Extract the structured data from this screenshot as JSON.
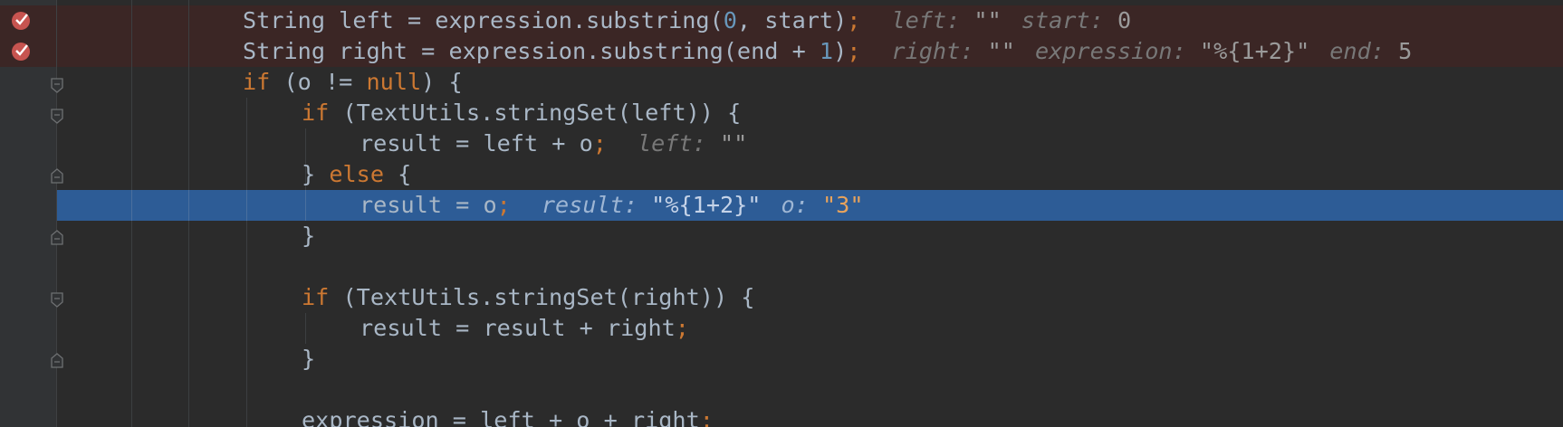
{
  "editor": {
    "lines": [
      {
        "id": "line-1",
        "tokens": [
          {
            "t": "String left = expression.substring(",
            "c": ""
          },
          {
            "t": "0",
            "c": "num"
          },
          {
            "t": ", start)",
            "c": ""
          },
          {
            "t": ";",
            "c": "semi"
          }
        ],
        "hints": [
          {
            "name": "left:",
            "value": "\"\""
          },
          {
            "name": "start:",
            "value": "0"
          }
        ]
      },
      {
        "id": "line-2",
        "tokens": [
          {
            "t": "String right = expression.substring(end + ",
            "c": ""
          },
          {
            "t": "1",
            "c": "num"
          },
          {
            "t": ")",
            "c": ""
          },
          {
            "t": ";",
            "c": "semi"
          }
        ],
        "hints": [
          {
            "name": "right:",
            "value": "\"\""
          },
          {
            "name": "expression:",
            "value": "\"%{1+2}\""
          },
          {
            "name": "end:",
            "value": "5"
          }
        ]
      },
      {
        "id": "line-3",
        "tokens": [
          {
            "t": "if",
            "c": "kw"
          },
          {
            "t": " (o != ",
            "c": ""
          },
          {
            "t": "null",
            "c": "kw"
          },
          {
            "t": ") {",
            "c": ""
          }
        ],
        "hints": []
      },
      {
        "id": "line-4",
        "tokens": [
          {
            "t": "if",
            "c": "kw"
          },
          {
            "t": " (TextUtils.stringSet(left)) {",
            "c": ""
          }
        ],
        "hints": []
      },
      {
        "id": "line-5",
        "tokens": [
          {
            "t": "result = left + o",
            "c": ""
          },
          {
            "t": ";",
            "c": "semi"
          }
        ],
        "hints": [
          {
            "name": "left:",
            "value": "\"\""
          }
        ]
      },
      {
        "id": "line-6",
        "tokens": [
          {
            "t": "} ",
            "c": ""
          },
          {
            "t": "else",
            "c": "kw"
          },
          {
            "t": " {",
            "c": ""
          }
        ],
        "hints": []
      },
      {
        "id": "line-7",
        "tokens": [
          {
            "t": "result = o",
            "c": ""
          },
          {
            "t": ";",
            "c": "semi"
          }
        ],
        "hints": [
          {
            "name": "result:",
            "value": "\"%{1+2}\""
          },
          {
            "name": "o:",
            "value": "\"3\"",
            "changed": true
          }
        ]
      },
      {
        "id": "line-8",
        "tokens": [
          {
            "t": "}",
            "c": ""
          }
        ],
        "hints": []
      },
      {
        "id": "line-9",
        "tokens": [],
        "hints": []
      },
      {
        "id": "line-10",
        "tokens": [
          {
            "t": "if",
            "c": "kw"
          },
          {
            "t": " (TextUtils.stringSet(right)) {",
            "c": ""
          }
        ],
        "hints": []
      },
      {
        "id": "line-11",
        "tokens": [
          {
            "t": "result = result + right",
            "c": ""
          },
          {
            "t": ";",
            "c": "semi"
          }
        ],
        "hints": []
      },
      {
        "id": "line-12",
        "tokens": [
          {
            "t": "}",
            "c": ""
          }
        ],
        "hints": []
      },
      {
        "id": "line-13",
        "tokens": [],
        "hints": []
      },
      {
        "id": "line-14",
        "tokens": [
          {
            "t": "expression = left + o + right",
            "c": ""
          },
          {
            "t": ";",
            "c": "semi"
          }
        ],
        "hints": []
      }
    ]
  },
  "colors": {
    "background": "#2b2b2b",
    "gutter": "#313335",
    "breakpoint_line": "#3b2625",
    "execution_line": "#2d5c96",
    "keyword": "#cc7832",
    "number": "#6897bb",
    "identifier": "#a9b7c6",
    "breakpoint_icon": "#c75450"
  },
  "icons": {
    "breakpoint": "breakpoint-verified-icon",
    "fold": "fold-marker-icon"
  }
}
